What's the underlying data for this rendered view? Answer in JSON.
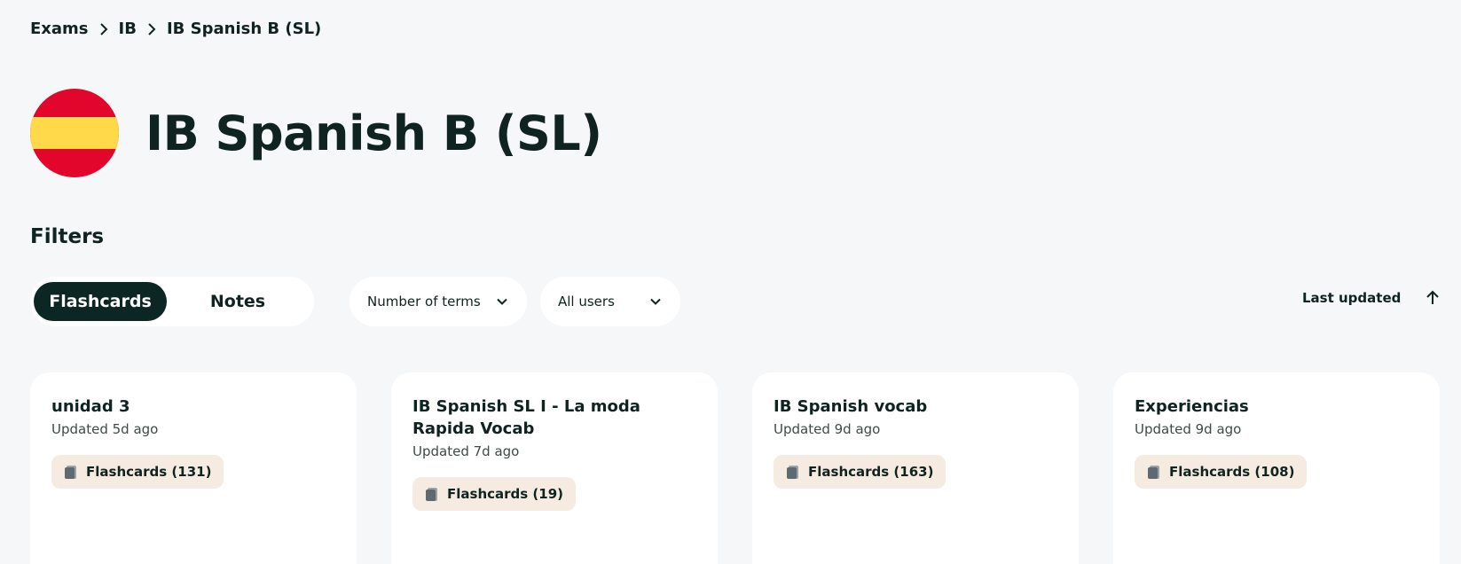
{
  "breadcrumb": {
    "items": [
      "Exams",
      "IB",
      "IB Spanish B (SL)"
    ]
  },
  "header": {
    "title": "IB Spanish B (SL)",
    "flag_colors": [
      "#e2062c",
      "#ffd94a"
    ]
  },
  "filters": {
    "heading": "Filters",
    "toggle": {
      "active": "Flashcards",
      "inactive": "Notes"
    },
    "terms_dropdown": "Number of terms",
    "users_dropdown": "All users",
    "sort_label": "Last updated"
  },
  "cards": [
    {
      "title": "unidad 3",
      "updated": "Updated 5d ago",
      "badge": "Flashcards (131)"
    },
    {
      "title": "IB Spanish SL I - La moda Rapida Vocab",
      "updated": "Updated 7d ago",
      "badge": "Flashcards (19)"
    },
    {
      "title": "IB Spanish vocab",
      "updated": "Updated 9d ago",
      "badge": "Flashcards (163)"
    },
    {
      "title": "Experiencias",
      "updated": "Updated 9d ago",
      "badge": "Flashcards (108)"
    }
  ],
  "icons": {
    "breadcrumb_separator": "chevron-right-icon",
    "dropdown": "chevron-down-icon",
    "sort": "arrow-up-icon",
    "badge": "flashcards-icon"
  }
}
